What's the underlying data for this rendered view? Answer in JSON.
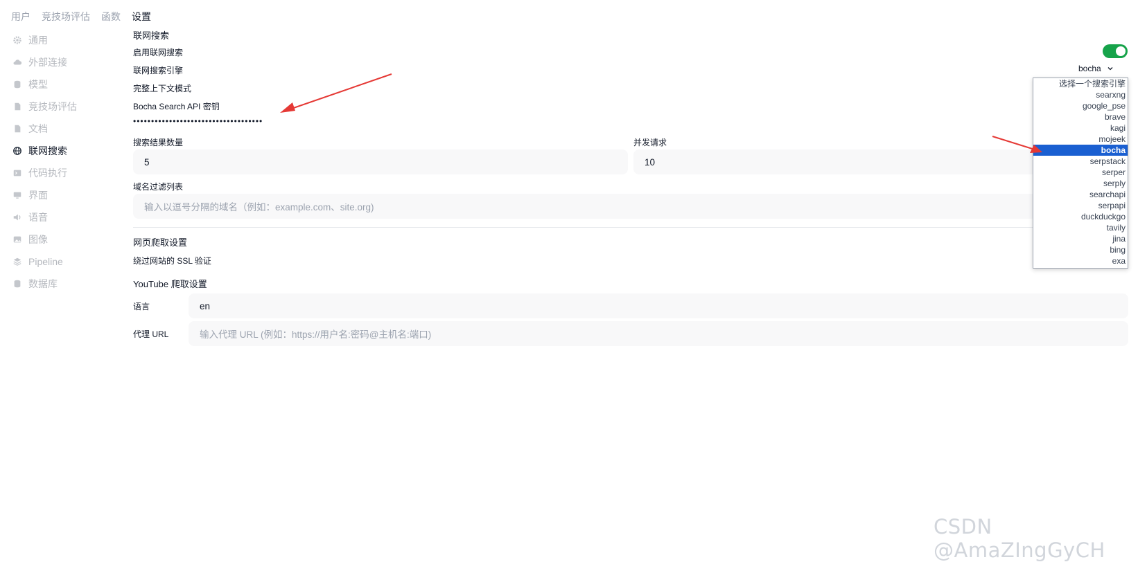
{
  "top_tabs": [
    "用户",
    "竞技场评估",
    "函数",
    "设置"
  ],
  "sidebar": {
    "items": [
      {
        "label": "通用",
        "icon": "gear-icon"
      },
      {
        "label": "外部连接",
        "icon": "cloud-icon"
      },
      {
        "label": "模型",
        "icon": "database-icon"
      },
      {
        "label": "竞技场评估",
        "icon": "document-icon"
      },
      {
        "label": "文档",
        "icon": "document-icon"
      },
      {
        "label": "联网搜索",
        "icon": "globe-icon"
      },
      {
        "label": "代码执行",
        "icon": "terminal-icon"
      },
      {
        "label": "界面",
        "icon": "monitor-icon"
      },
      {
        "label": "语音",
        "icon": "speaker-icon"
      },
      {
        "label": "图像",
        "icon": "image-icon"
      },
      {
        "label": "Pipeline",
        "icon": "layers-icon"
      },
      {
        "label": "数据库",
        "icon": "database-icon"
      }
    ]
  },
  "main": {
    "web_search_title": "联网搜索",
    "enable_label": "启用联网搜索",
    "enable_state": "on",
    "engine_label": "联网搜索引擎",
    "engine_value": "bocha",
    "full_context_label": "完整上下文模式",
    "api_key_label": "Bocha Search API 密钥",
    "api_key_value": "••••••••••••••••••••••••••••••••••••",
    "result_count_label": "搜索结果数量",
    "result_count_value": "5",
    "concurrent_label": "并发请求",
    "concurrent_value": "10",
    "domain_filter_label": "域名过滤列表",
    "domain_filter_placeholder": "输入以逗号分隔的域名（例如：example.com、site.org)",
    "crawl_title": "网页爬取设置",
    "ssl_label": "绕过网站的 SSL 验证",
    "youtube_title": "YouTube 爬取设置",
    "language_label": "语言",
    "language_value": "en",
    "proxy_label": "代理 URL",
    "proxy_placeholder": "输入代理 URL (例如：https://用户名:密码@主机名:端口)"
  },
  "dropdown": {
    "options": [
      "选择一个搜索引擎",
      "searxng",
      "google_pse",
      "brave",
      "kagi",
      "mojeek",
      "bocha",
      "serpstack",
      "serper",
      "serply",
      "searchapi",
      "serpapi",
      "duckduckgo",
      "tavily",
      "jina",
      "bing",
      "exa"
    ],
    "selected": "bocha"
  },
  "colors": {
    "toggle_on": "#16a34a",
    "selected_option": "#1a5fd1",
    "arrow": "#e53935"
  },
  "watermark": "CSDN @AmaZIngGyCH"
}
